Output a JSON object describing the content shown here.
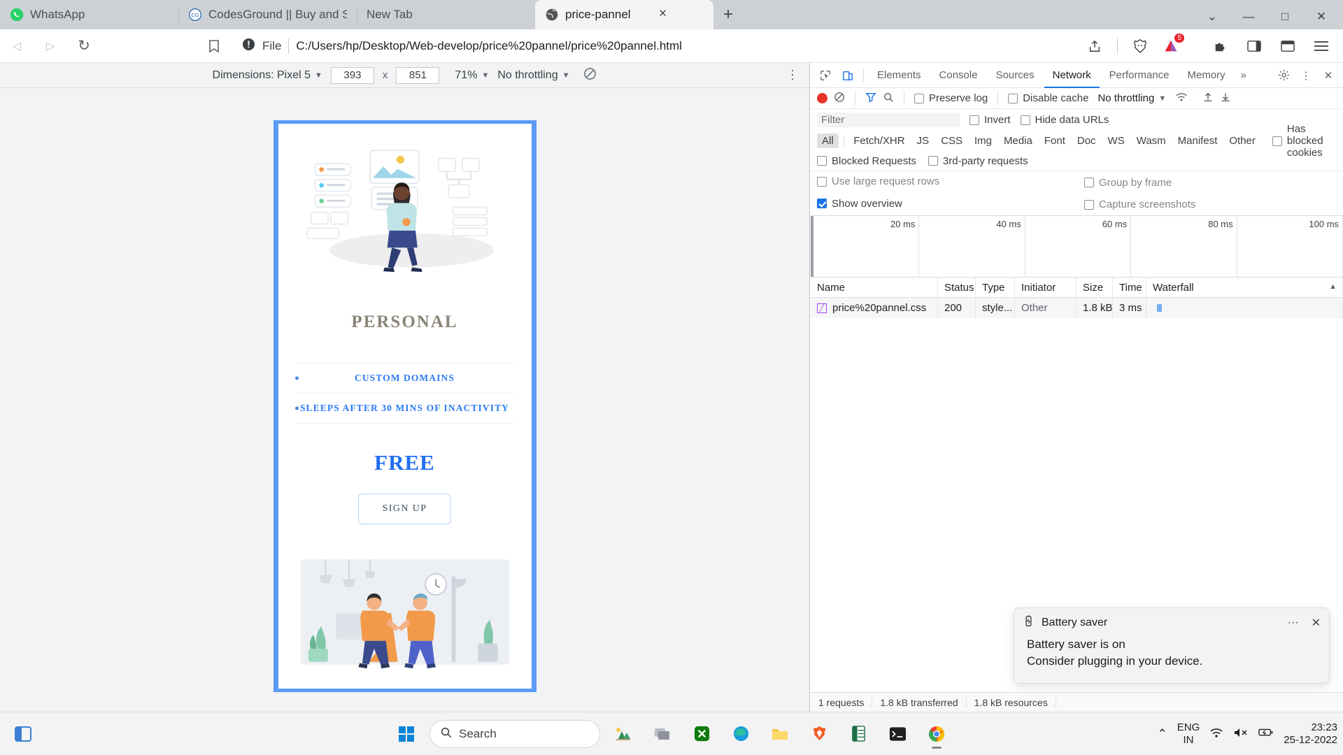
{
  "browser": {
    "tabs": [
      {
        "title": "WhatsApp",
        "favicon": "whatsapp-icon",
        "active": false
      },
      {
        "title": "CodesGround || Buy and Sell Codes Online",
        "favicon": "codesground-icon",
        "active": false
      },
      {
        "title": "New Tab",
        "favicon": "none",
        "active": false
      },
      {
        "title": "price-pannel",
        "favicon": "globe-icon",
        "active": true
      }
    ],
    "new_tab_label": "+",
    "close_label": "×",
    "window_controls": {
      "minimize": "—",
      "maximize": "□",
      "close": "✕",
      "chevron": "⌄"
    },
    "nav": {
      "back": "◁",
      "forward": "▷",
      "reload": "↻",
      "bookmark": "bookmark-icon",
      "security_label": "File",
      "url": "C:/Users/hp/Desktop/Web-develop/price%20pannel/price%20pannel.html",
      "share": "share-icon",
      "brave_shields": "brave-lion-icon",
      "extension_badge_count": "5",
      "extensions": "puzzle-icon",
      "sidebar": "sidebar-icon",
      "collections": "collections-icon",
      "menu": "hamburger-menu-icon"
    }
  },
  "device_toolbar": {
    "dimensions_label": "Dimensions: Pixel 5",
    "width": "393",
    "times": "x",
    "height": "851",
    "zoom": "71%",
    "throttling": "No throttling",
    "rotate_icon": "rotate-icon",
    "more_icon": "more-vertical-icon"
  },
  "pricing_card": {
    "plan_title": "PERSONAL",
    "features": [
      "CUSTOM DOMAINS",
      "SLEEPS AFTER 30 MINS OF INACTIVITY"
    ],
    "price": "FREE",
    "signup_label": "SIGN UP"
  },
  "devtools": {
    "tool_icons": {
      "inspect": "inspect-element-icon",
      "device": "device-toolbar-icon"
    },
    "tabs": [
      {
        "label": "Elements",
        "active": false
      },
      {
        "label": "Console",
        "active": false
      },
      {
        "label": "Sources",
        "active": false
      },
      {
        "label": "Network",
        "active": true
      },
      {
        "label": "Performance",
        "active": false
      },
      {
        "label": "Memory",
        "active": false
      }
    ],
    "more_tabs": "»",
    "settings_icon": "gear-icon",
    "kebab_icon": "more-vertical-icon",
    "close_icon": "close-icon",
    "controls": {
      "record": "record-icon",
      "clear": "clear-icon",
      "filter": "filter-icon",
      "search": "search-icon",
      "preserve_log": "Preserve log",
      "disable_cache": "Disable cache",
      "throttling": "No throttling",
      "wifi_icon": "network-conditions-icon",
      "import_icon": "import-har-icon",
      "export_icon": "export-har-icon"
    },
    "filter": {
      "placeholder": "Filter",
      "value": "",
      "invert": "Invert",
      "hide_data_urls": "Hide data URLs"
    },
    "resource_types": [
      "All",
      "Fetch/XHR",
      "JS",
      "CSS",
      "Img",
      "Media",
      "Font",
      "Doc",
      "WS",
      "Wasm",
      "Manifest",
      "Other"
    ],
    "selected_type": "All",
    "has_blocked_cookies": "Has blocked cookies",
    "blocked_requests": "Blocked Requests",
    "third_party_requests": "3rd-party requests",
    "use_large_request_rows": "Use large request rows",
    "group_by_frame": "Group by frame",
    "show_overview": "Show overview",
    "capture_screenshots": "Capture screenshots",
    "show_overview_checked": true,
    "overview_ticks": [
      "20 ms",
      "40 ms",
      "60 ms",
      "80 ms",
      "100 ms"
    ],
    "table": {
      "columns": [
        "Name",
        "Status",
        "Type",
        "Initiator",
        "Size",
        "Time",
        "Waterfall"
      ],
      "rows": [
        {
          "name": "price%20pannel.css",
          "status": "200",
          "type": "style...",
          "initiator": "Other",
          "size": "1.8 kB",
          "time": "3 ms"
        }
      ]
    },
    "status_bar": [
      "1 requests",
      "1.8 kB transferred",
      "1.8 kB resources"
    ]
  },
  "toast": {
    "icon": "battery-saver-icon",
    "title": "Battery saver",
    "more": "···",
    "close": "✕",
    "line1": "Battery saver is on",
    "line2": "Consider plugging in your device."
  },
  "taskbar": {
    "widgets_icon": "widgets-icon",
    "start_icon": "windows-start-icon",
    "search_placeholder": "Search",
    "search_icon": "search-icon",
    "apps": [
      "weather-icon",
      "task-view-icon",
      "xbox-icon",
      "edge-icon",
      "file-explorer-icon",
      "brave-icon",
      "excel-icon",
      "terminal-icon",
      "chrome-icon"
    ],
    "tray": {
      "chevron": "⌃",
      "language_line1": "ENG",
      "language_line2": "IN",
      "wifi_icon": "wifi-icon",
      "volume_icon": "volume-muted-icon",
      "battery_icon": "battery-saver-icon",
      "time": "23:23",
      "date": "25-12-2022"
    }
  },
  "colors": {
    "accent_blue": "#1a73e8",
    "card_border": "#5b9bf8",
    "price_blue": "#1f6ef0",
    "plan_gray": "#8a8577",
    "taskbar_bg": "#f3f3f3"
  }
}
